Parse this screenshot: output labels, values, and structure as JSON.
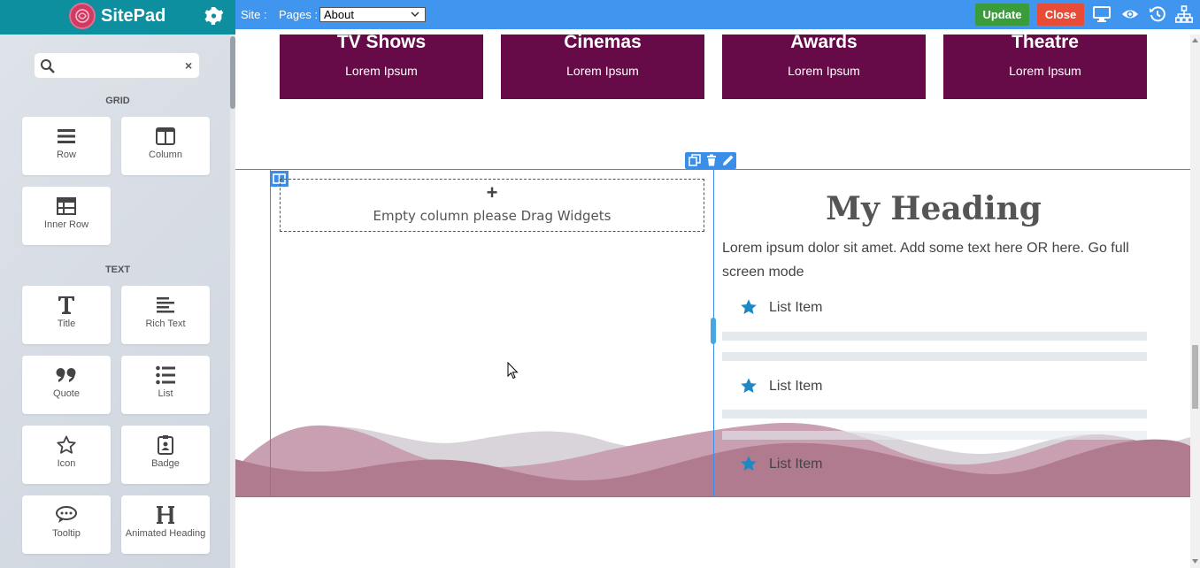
{
  "brand": {
    "name": "SitePad"
  },
  "sidebar": {
    "search": {
      "value": "",
      "placeholder": ""
    },
    "grid_title": "GRID",
    "grid_widgets": [
      {
        "label": "Row",
        "icon": "row-icon"
      },
      {
        "label": "Column",
        "icon": "column-icon"
      },
      {
        "label": "Inner Row",
        "icon": "inner-row-icon"
      }
    ],
    "text_title": "TEXT",
    "text_widgets": [
      {
        "label": "Title",
        "icon": "title-icon"
      },
      {
        "label": "Rich Text",
        "icon": "rich-text-icon"
      },
      {
        "label": "Quote",
        "icon": "quote-icon"
      },
      {
        "label": "List",
        "icon": "list-icon"
      },
      {
        "label": "Icon",
        "icon": "star-outline-icon"
      },
      {
        "label": "Badge",
        "icon": "badge-icon"
      },
      {
        "label": "Tooltip",
        "icon": "tooltip-icon"
      },
      {
        "label": "Animated Heading",
        "icon": "animated-heading-icon"
      }
    ],
    "collapse_glyph": "‹"
  },
  "toolbar": {
    "site_label": "Site :",
    "pages_label": "Pages :",
    "pages_selected": "About",
    "update_label": "Update",
    "close_label": "Close",
    "icons": [
      "desktop-icon",
      "eye-icon",
      "history-icon",
      "sitemap-icon"
    ]
  },
  "canvas": {
    "cards": [
      {
        "title": "TV Shows",
        "subtitle": "Lorem Ipsum"
      },
      {
        "title": "Cinemas",
        "subtitle": "Lorem Ipsum"
      },
      {
        "title": "Awards",
        "subtitle": "Lorem Ipsum"
      },
      {
        "title": "Theatre",
        "subtitle": "Lorem Ipsum"
      }
    ],
    "empty_plus": "+",
    "empty_column_text": "Empty column please Drag Widgets",
    "heading": "My Heading",
    "paragraph": "Lorem ipsum dolor sit amet. Add some text here OR here. Go full screen mode",
    "list_items": [
      "List Item",
      "List Item",
      "List Item"
    ]
  },
  "colors": {
    "brand_bar": "#0d8fa0",
    "toolbar": "#4096ee",
    "card": "#670a48",
    "update": "#3a9c3a",
    "close": "#e94c36",
    "star": "#1e88c7"
  }
}
